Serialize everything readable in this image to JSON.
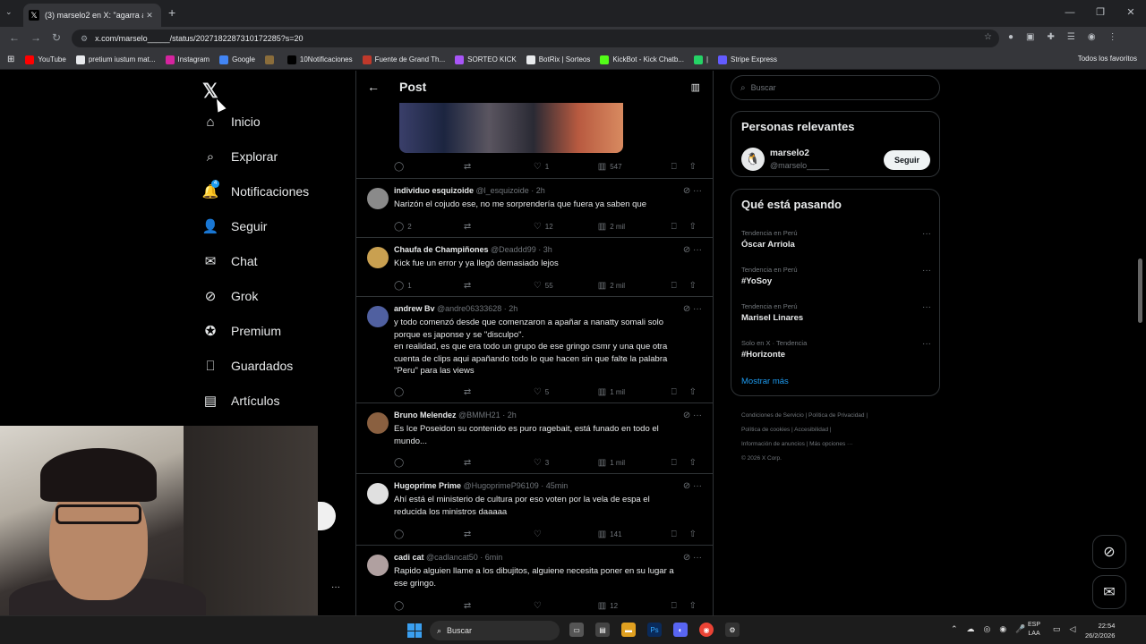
{
  "browser": {
    "tab_title": "(3) marselo2 en X: \"agarra al ca",
    "url": "x.com/marselo_____/status/2027182287310172285?s=20",
    "bookmarks": [
      {
        "label": "YouTube",
        "color": "#ff0000"
      },
      {
        "label": "pretium iustum mat...",
        "color": "#e8eaed"
      },
      {
        "label": "Instagram",
        "color": "#d6249f"
      },
      {
        "label": "Google",
        "color": "#4285f4"
      },
      {
        "label": "",
        "color": "#8a6d3b"
      },
      {
        "label": "10Notificaciones",
        "color": "#000000"
      },
      {
        "label": "Fuente de Grand Th...",
        "color": "#c0392b"
      },
      {
        "label": "SORTEO KICK",
        "color": "#a855f7"
      },
      {
        "label": "BotRix | Sorteos",
        "color": "#e8eaed"
      },
      {
        "label": "KickBot - Kick Chatb...",
        "color": "#53fc18"
      },
      {
        "label": "|",
        "color": "#25d366"
      },
      {
        "label": "Stripe Express",
        "color": "#635bff"
      }
    ],
    "all_bookmarks": "Todos los favoritos"
  },
  "nav": {
    "items": [
      {
        "label": "Inicio",
        "icon": "home-icon"
      },
      {
        "label": "Explorar",
        "icon": "search-icon"
      },
      {
        "label": "Notificaciones",
        "icon": "bell-icon"
      },
      {
        "label": "Seguir",
        "icon": "follow-icon"
      },
      {
        "label": "Chat",
        "icon": "mail-icon"
      },
      {
        "label": "Grok",
        "icon": "grok-icon"
      },
      {
        "label": "Premium",
        "icon": "premium-icon"
      },
      {
        "label": "Guardados",
        "icon": "bookmark-icon"
      },
      {
        "label": "Artículos",
        "icon": "articles-icon"
      }
    ],
    "notif_badge": "4"
  },
  "post": {
    "header_title": "Post",
    "main_actions": {
      "replies": "",
      "reposts": "",
      "likes": "1",
      "views": "547"
    }
  },
  "replies": [
    {
      "name": "individuo esquizoide",
      "handle": "@l_esquizoide",
      "time": "2h",
      "text": "Narizón el cojudo ese, no me sorprendería que fuera ya saben que",
      "replies": "2",
      "reposts": "",
      "likes": "12",
      "views": "2 mil",
      "avatar": "#8a8a8a"
    },
    {
      "name": "Chaufa de Champiñones",
      "handle": "@Deaddd99",
      "time": "3h",
      "text": "Kick fue un error y ya llegó demasiado lejos",
      "replies": "1",
      "reposts": "",
      "likes": "55",
      "views": "2 mil",
      "avatar": "#c9a050"
    },
    {
      "name": "andrew Bv",
      "handle": "@andre06333628",
      "time": "2h",
      "text": "y todo comenzó  desde que comenzaron a apañar a nanatty somali solo\nporque es japonse y se \"disculpo\".\nen realidad, es que era todo un grupo de ese gringo csmr y una que otra\ncuenta de clips aqui apañando todo lo que hacen sin que falte la palabra\n\"Peru\" para las views",
      "replies": "",
      "reposts": "",
      "likes": "5",
      "views": "1 mil",
      "avatar": "#5060a0"
    },
    {
      "name": "Bruno Melendez",
      "handle": "@BMMH21",
      "time": "2h",
      "text": "Es Ice Poseidon su contenido es puro ragebait, está funado en todo el\nmundo...",
      "replies": "",
      "reposts": "",
      "likes": "3",
      "views": "1 mil",
      "avatar": "#8a6040"
    },
    {
      "name": "Hugoprime Prime",
      "handle": "@HugoprimeP96109",
      "time": "45min",
      "text": "Ahí está el ministerio de cultura por eso voten por la vela de espa el\nreducida los ministros daaaaa",
      "replies": "",
      "reposts": "",
      "likes": "",
      "views": "141",
      "avatar": "#e0e0e0"
    },
    {
      "name": "cadi cat",
      "handle": "@cadlancat50",
      "time": "6min",
      "text": "Rapido alguien llame a los dibujitos, alguiene necesita poner en su lugar a\nese gringo.",
      "replies": "",
      "reposts": "",
      "likes": "",
      "views": "12",
      "avatar": "#b0a0a0"
    }
  ],
  "sidebar": {
    "search_placeholder": "Buscar",
    "relevant_title": "Personas relevantes",
    "relevant_user": {
      "name": "marselo2",
      "handle": "@marselo_____",
      "follow_label": "Seguir"
    },
    "trending_title": "Qué está pasando",
    "trends": [
      {
        "meta": "Tendencia en Perú",
        "name": "Óscar Arriola"
      },
      {
        "meta": "Tendencia en Perú",
        "name": "#YoSoy"
      },
      {
        "meta": "Tendencia en Perú",
        "name": "Marisel Linares"
      },
      {
        "meta": "Solo en X · Tendencia",
        "name": "#Horizonte"
      }
    ],
    "show_more": "Mostrar más",
    "footer_lines": [
      "Condiciones de Servicio  |  Política de Privacidad  |",
      "Política de cookies  |  Accesibilidad  |",
      "Información de anuncios  |  Más opciones ···",
      "© 2026 X Corp."
    ]
  },
  "taskbar": {
    "search_label": "Buscar",
    "lang": "ESP",
    "lang2": "LAA",
    "time": "22:54",
    "date": "26/2/2026"
  }
}
